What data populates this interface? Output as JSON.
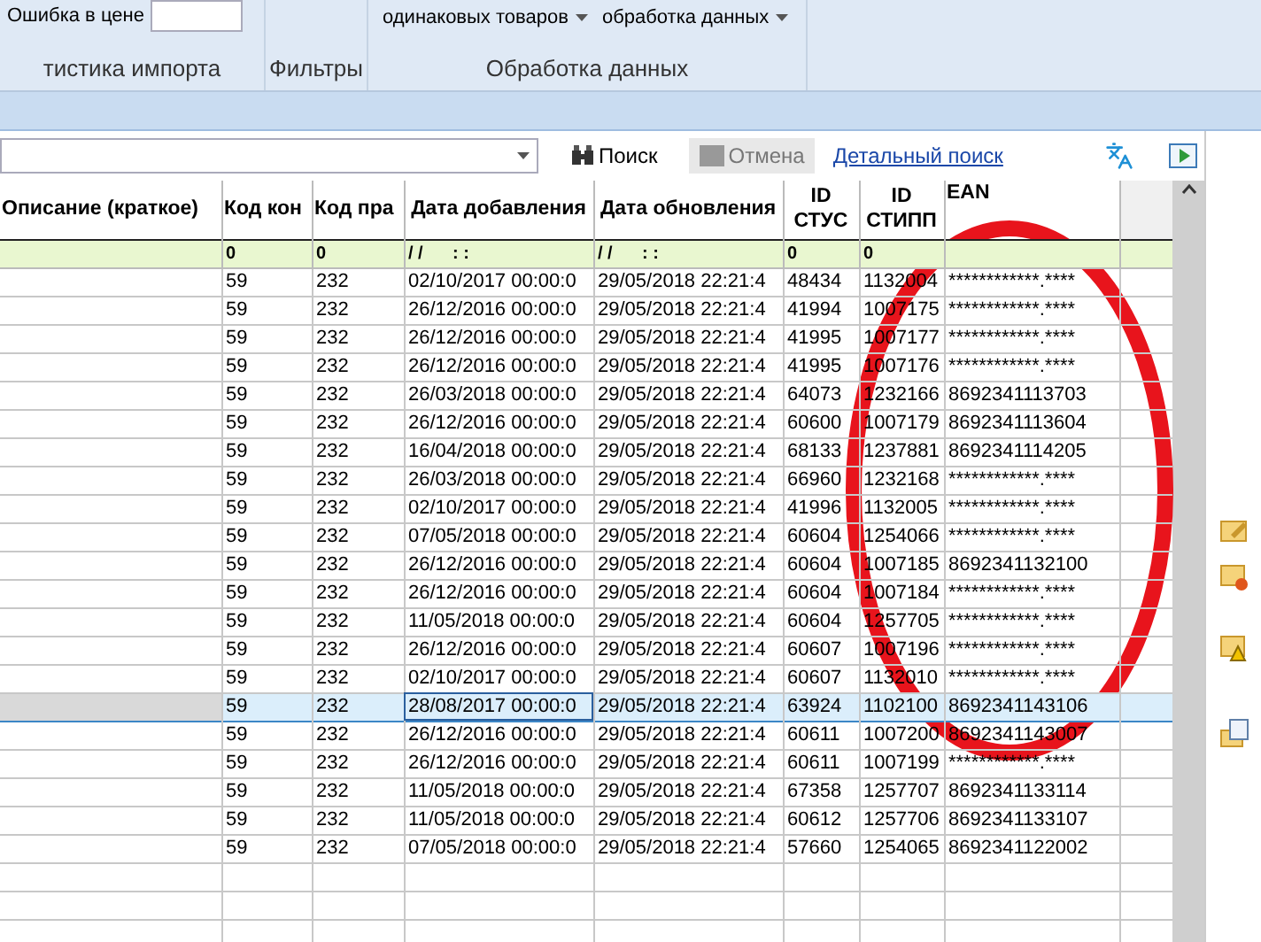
{
  "ribbon": {
    "field_label": "Ошибка в цене",
    "groups": [
      {
        "label": "тистика импорта"
      },
      {
        "label": "Фильтры"
      },
      {
        "label": "Обработка данных"
      }
    ],
    "dropdowns": [
      "одинаковых товаров",
      "обработка данных"
    ]
  },
  "toolbar": {
    "search_button": "Поиск",
    "cancel_button": {
      "label": "Отмена",
      "disabled": true
    },
    "detail_link": "Детальный поиск"
  },
  "table": {
    "description_header": "Описание (краткое)",
    "columns": [
      "Код кон",
      "Код пра",
      "Дата добавления",
      "Дата обновления",
      "ID СТУС",
      "ID СТИПП",
      "EAN"
    ],
    "filter_row": [
      "0",
      "0",
      "/ /      : :",
      "/ /      : :",
      "0",
      "0"
    ],
    "rows": [
      {
        "selected": false,
        "cells": [
          "59",
          "232",
          "02/10/2017 00:00:0",
          "29/05/2018 22:21:4",
          "48434",
          "1132004",
          "************.****"
        ]
      },
      {
        "selected": false,
        "cells": [
          "59",
          "232",
          "26/12/2016 00:00:0",
          "29/05/2018 22:21:4",
          "41994",
          "1007175",
          "************.****"
        ]
      },
      {
        "selected": false,
        "cells": [
          "59",
          "232",
          "26/12/2016 00:00:0",
          "29/05/2018 22:21:4",
          "41995",
          "1007177",
          "************.****"
        ]
      },
      {
        "selected": false,
        "cells": [
          "59",
          "232",
          "26/12/2016 00:00:0",
          "29/05/2018 22:21:4",
          "41995",
          "1007176",
          "************.****"
        ]
      },
      {
        "selected": false,
        "cells": [
          "59",
          "232",
          "26/03/2018 00:00:0",
          "29/05/2018 22:21:4",
          "64073",
          "1232166",
          "8692341113703"
        ]
      },
      {
        "selected": false,
        "cells": [
          "59",
          "232",
          "26/12/2016 00:00:0",
          "29/05/2018 22:21:4",
          "60600",
          "1007179",
          "8692341113604"
        ]
      },
      {
        "selected": false,
        "cells": [
          "59",
          "232",
          "16/04/2018 00:00:0",
          "29/05/2018 22:21:4",
          "68133",
          "1237881",
          "8692341114205"
        ]
      },
      {
        "selected": false,
        "cells": [
          "59",
          "232",
          "26/03/2018 00:00:0",
          "29/05/2018 22:21:4",
          "66960",
          "1232168",
          "************.****"
        ]
      },
      {
        "selected": false,
        "cells": [
          "59",
          "232",
          "02/10/2017 00:00:0",
          "29/05/2018 22:21:4",
          "41996",
          "1132005",
          "************.****"
        ]
      },
      {
        "selected": false,
        "cells": [
          "59",
          "232",
          "07/05/2018 00:00:0",
          "29/05/2018 22:21:4",
          "60604",
          "1254066",
          "************.****"
        ]
      },
      {
        "selected": false,
        "cells": [
          "59",
          "232",
          "26/12/2016 00:00:0",
          "29/05/2018 22:21:4",
          "60604",
          "1007185",
          "8692341132100"
        ]
      },
      {
        "selected": false,
        "cells": [
          "59",
          "232",
          "26/12/2016 00:00:0",
          "29/05/2018 22:21:4",
          "60604",
          "1007184",
          "************.****"
        ]
      },
      {
        "selected": false,
        "cells": [
          "59",
          "232",
          "11/05/2018 00:00:0",
          "29/05/2018 22:21:4",
          "60604",
          "1257705",
          "************.****"
        ]
      },
      {
        "selected": false,
        "cells": [
          "59",
          "232",
          "26/12/2016 00:00:0",
          "29/05/2018 22:21:4",
          "60607",
          "1007196",
          "************.****"
        ]
      },
      {
        "selected": false,
        "cells": [
          "59",
          "232",
          "02/10/2017 00:00:0",
          "29/05/2018 22:21:4",
          "60607",
          "1132010",
          "************.****"
        ]
      },
      {
        "selected": true,
        "cells": [
          "59",
          "232",
          "28/08/2017 00:00:0",
          "29/05/2018 22:21:4",
          "63924",
          "1102100",
          "8692341143106"
        ]
      },
      {
        "selected": false,
        "cells": [
          "59",
          "232",
          "26/12/2016 00:00:0",
          "29/05/2018 22:21:4",
          "60611",
          "1007200",
          "8692341143007"
        ]
      },
      {
        "selected": false,
        "cells": [
          "59",
          "232",
          "26/12/2016 00:00:0",
          "29/05/2018 22:21:4",
          "60611",
          "1007199",
          "************.****"
        ]
      },
      {
        "selected": false,
        "cells": [
          "59",
          "232",
          "11/05/2018 00:00:0",
          "29/05/2018 22:21:4",
          "67358",
          "1257707",
          "8692341133114"
        ]
      },
      {
        "selected": false,
        "cells": [
          "59",
          "232",
          "11/05/2018 00:00:0",
          "29/05/2018 22:21:4",
          "60612",
          "1257706",
          "8692341133107"
        ]
      },
      {
        "selected": false,
        "cells": [
          "59",
          "232",
          "07/05/2018 00:00:0",
          "29/05/2018 22:21:4",
          "57660",
          "1254065",
          "8692341122002"
        ]
      }
    ]
  }
}
